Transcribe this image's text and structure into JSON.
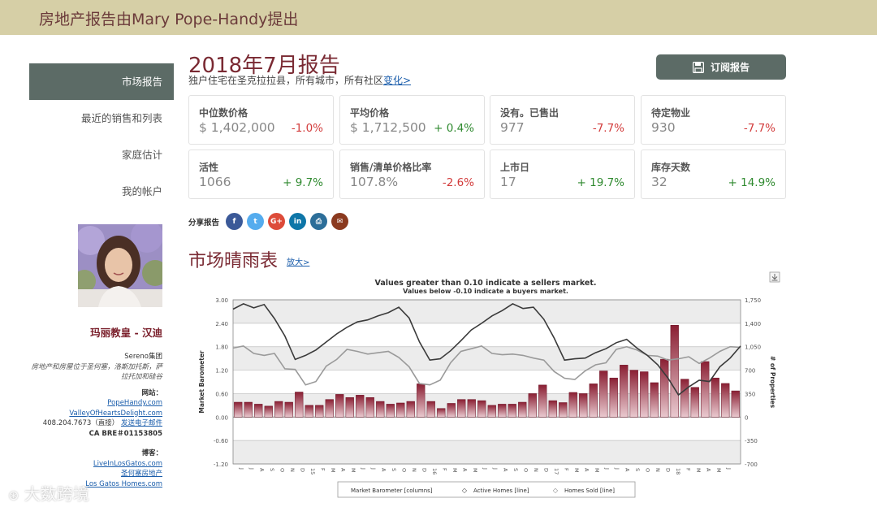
{
  "header": {
    "title": "房地产报告由Mary Pope-Handy提出"
  },
  "sidebar": {
    "items": [
      {
        "label": "市场报告",
        "active": true
      },
      {
        "label": "最近的销售和列表",
        "active": false
      },
      {
        "label": "家庭估计",
        "active": false
      },
      {
        "label": "我的帐户",
        "active": false
      }
    ]
  },
  "agent": {
    "name": "玛丽教皇 - 汉迪",
    "company": "Sereno集团",
    "specialty": "房地产和房屋位于圣何塞，洛斯加托斯，萨拉托加和硅谷",
    "website_label": "网站：",
    "website1": "PopeHandy.com",
    "website2": "ValleyOfHeartsDelight.com",
    "phone": "408.204.7673（直接）",
    "email_link": "发送电子邮件",
    "license": "CA BRE＃01153805",
    "blog_label": "博客：",
    "blog1": "LiveInLosGatos.com",
    "blog2": "圣何塞房地产",
    "blog3": "Los Gatos Homes.com"
  },
  "report": {
    "title": "2018年7月报告",
    "subtitle": "独户住宅在圣克拉拉县，所有城市，所有社区",
    "change_link": "变化>",
    "subscribe_label": "订阅报告"
  },
  "stats": [
    {
      "label": "中位数价格",
      "value": "$ 1,402,000",
      "change": "-1.0%",
      "dir": "neg"
    },
    {
      "label": "平均价格",
      "value": "$ 1,712,500",
      "change": "+ 0.4%",
      "dir": "pos"
    },
    {
      "label": "没有。已售出",
      "value": "977",
      "change": "-7.7%",
      "dir": "neg"
    },
    {
      "label": "待定物业",
      "value": "930",
      "change": "-7.7%",
      "dir": "neg"
    },
    {
      "label": "活性",
      "value": "1066",
      "change": "+ 9.7%",
      "dir": "pos"
    },
    {
      "label": "销售/清单价格比率",
      "value": "107.8%",
      "change": "-2.6%",
      "dir": "neg"
    },
    {
      "label": "上市日",
      "value": "17",
      "change": "+ 19.7%",
      "dir": "pos"
    },
    {
      "label": "库存天数",
      "value": "32",
      "change": "+ 14.9%",
      "dir": "pos"
    }
  ],
  "share": {
    "label": "分享报告",
    "icons": [
      {
        "name": "facebook-icon",
        "glyph": "f",
        "color": "#3b5998"
      },
      {
        "name": "twitter-icon",
        "glyph": "t",
        "color": "#55acee"
      },
      {
        "name": "google-plus-icon",
        "glyph": "G+",
        "color": "#dd4b39"
      },
      {
        "name": "linkedin-icon",
        "glyph": "in",
        "color": "#0e76a8"
      },
      {
        "name": "print-icon",
        "glyph": "⎙",
        "color": "#2c6e99"
      },
      {
        "name": "email-icon",
        "glyph": "✉",
        "color": "#8b3a1f"
      }
    ]
  },
  "section": {
    "title": "市场晴雨表",
    "zoom_link": "放大>"
  },
  "watermark": "大数跨境",
  "chart_data": {
    "type": "bar",
    "title": "Values greater than 0.10 indicate a sellers market.",
    "subtitle": "Values below -0.10 indicate a buyers market.",
    "ylabel": "Market Barometer",
    "y2label": "# of Properties",
    "ylim": [
      -1.2,
      3.0
    ],
    "y2lim": [
      -700,
      1750
    ],
    "yticks": [
      "3.00",
      "2.40",
      "1.80",
      "1.20",
      "0.60",
      "0.00",
      "-0.60",
      "-1.20"
    ],
    "y2ticks": [
      "1,750",
      "1,400",
      "1,050",
      "700",
      "350",
      "0",
      "-350",
      "-700"
    ],
    "x": [
      "J",
      "J",
      "A",
      "S",
      "O",
      "N",
      "D",
      "15",
      "F",
      "M",
      "A",
      "M",
      "J",
      "J",
      "A",
      "S",
      "O",
      "N",
      "D",
      "16",
      "F",
      "M",
      "A",
      "M",
      "J",
      "J",
      "A",
      "S",
      "O",
      "N",
      "D",
      "17",
      "F",
      "M",
      "A",
      "M",
      "J",
      "J",
      "A",
      "S",
      "O",
      "N",
      "D",
      "18",
      "F",
      "M",
      "A",
      "M",
      "J"
    ],
    "grid": true,
    "legend_position": "bottom",
    "series": [
      {
        "name": "Market Barometer [columns]",
        "axis": "left",
        "values": [
          0.38,
          0.38,
          0.33,
          0.28,
          0.4,
          0.38,
          0.64,
          0.3,
          0.3,
          0.45,
          0.58,
          0.5,
          0.56,
          0.5,
          0.4,
          0.33,
          0.36,
          0.4,
          0.85,
          0.4,
          0.22,
          0.35,
          0.45,
          0.45,
          0.42,
          0.3,
          0.33,
          0.33,
          0.38,
          0.6,
          0.82,
          0.42,
          0.37,
          0.63,
          0.6,
          0.85,
          1.18,
          1.0,
          1.33,
          1.2,
          1.16,
          0.88,
          1.48,
          2.35,
          0.97,
          0.76,
          1.42,
          1.0,
          0.86,
          0.67
        ]
      },
      {
        "name": "Active Homes [line]",
        "axis": "right",
        "values": [
          1610,
          1690,
          1630,
          1680,
          1470,
          1210,
          860,
          920,
          1000,
          1120,
          1240,
          1340,
          1420,
          1450,
          1510,
          1560,
          1640,
          1480,
          1120,
          850,
          870,
          990,
          1140,
          1300,
          1400,
          1510,
          1590,
          1690,
          1620,
          1640,
          1460,
          1180,
          850,
          870,
          880,
          960,
          1020,
          1110,
          1160,
          1030,
          920,
          780,
          580,
          330,
          450,
          550,
          530,
          750,
          880,
          1060
        ]
      },
      {
        "name": "Homes Sold [line]",
        "axis": "right",
        "values": [
          1030,
          1060,
          950,
          920,
          950,
          720,
          710,
          480,
          530,
          760,
          860,
          1010,
          980,
          940,
          960,
          980,
          890,
          750,
          500,
          480,
          550,
          810,
          980,
          1020,
          1060,
          950,
          930,
          940,
          920,
          880,
          850,
          680,
          580,
          560,
          690,
          780,
          810,
          1010,
          1050,
          1000,
          920,
          910,
          850,
          870,
          900,
          800,
          880,
          980,
          1050,
          1040
        ]
      }
    ]
  }
}
